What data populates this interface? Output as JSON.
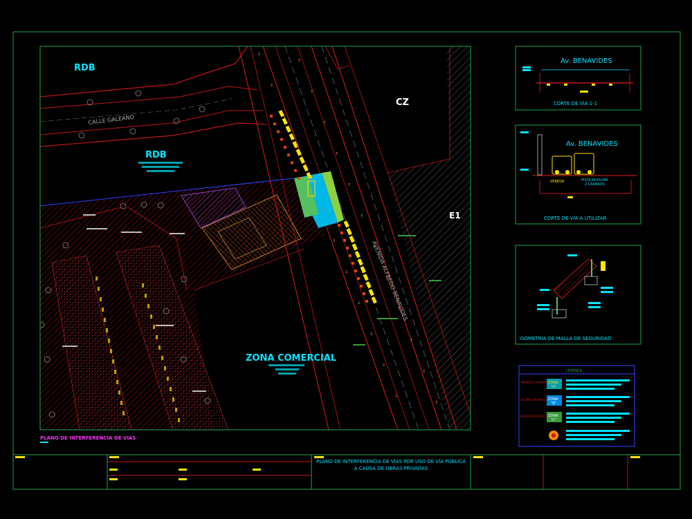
{
  "plan": {
    "labels": {
      "rdb_north": "RDB",
      "rdb_south": "RDB",
      "cz": "CZ",
      "e1": "E1",
      "street": "CALLE GALEANO",
      "avenue": "AVENIDA ALFREDO BENAVIDES",
      "zone": "ZONA COMERCIAL"
    },
    "caption": "PLANO DE INTERFERENCIA DE VÍAS"
  },
  "details": {
    "d1": {
      "street": "Av. BENAVIDES",
      "caption": "CORTE DE VÍA 1-1"
    },
    "d2": {
      "street": "Av. BENAVIDES",
      "lbl_vereda": "VEREDA",
      "lbl_pista": "PISTA AUXILIAR",
      "lbl_carriles": "2 CARRILES",
      "caption": "CORTE DE VÍA A UTILIZAR"
    },
    "d3": {
      "caption": "ISOMETRÍA DE MALLA DE SEGURIDAD"
    }
  },
  "legend": {
    "title": "LEYENDA",
    "items": [
      {
        "side": "TRÁNSITO PEATONAL",
        "tag1": "ZONA",
        "tag2": "\"A\""
      },
      {
        "side": "OCUPACIÓN PARCIAL",
        "tag1": "ZONA",
        "tag2": "\"B\""
      },
      {
        "side": "OCUPACIÓN PARCIAL",
        "tag1": "ZONA",
        "tag2": "\"C\""
      }
    ]
  },
  "title_block": {
    "line1": "PLANO DE INTERFERENCIA DE VÍAS POR USO DE VÍA PÚBLICA",
    "line2": "A CAUSA DE OBRAS PRIVADAS"
  },
  "colors": {
    "frame": "#1aa84a",
    "cyan": "#00e5ff",
    "yellow": "#ffe600",
    "red": "#d01818",
    "magenta": "#ff30ff",
    "blue": "#2233dd",
    "road": "#c01818"
  }
}
